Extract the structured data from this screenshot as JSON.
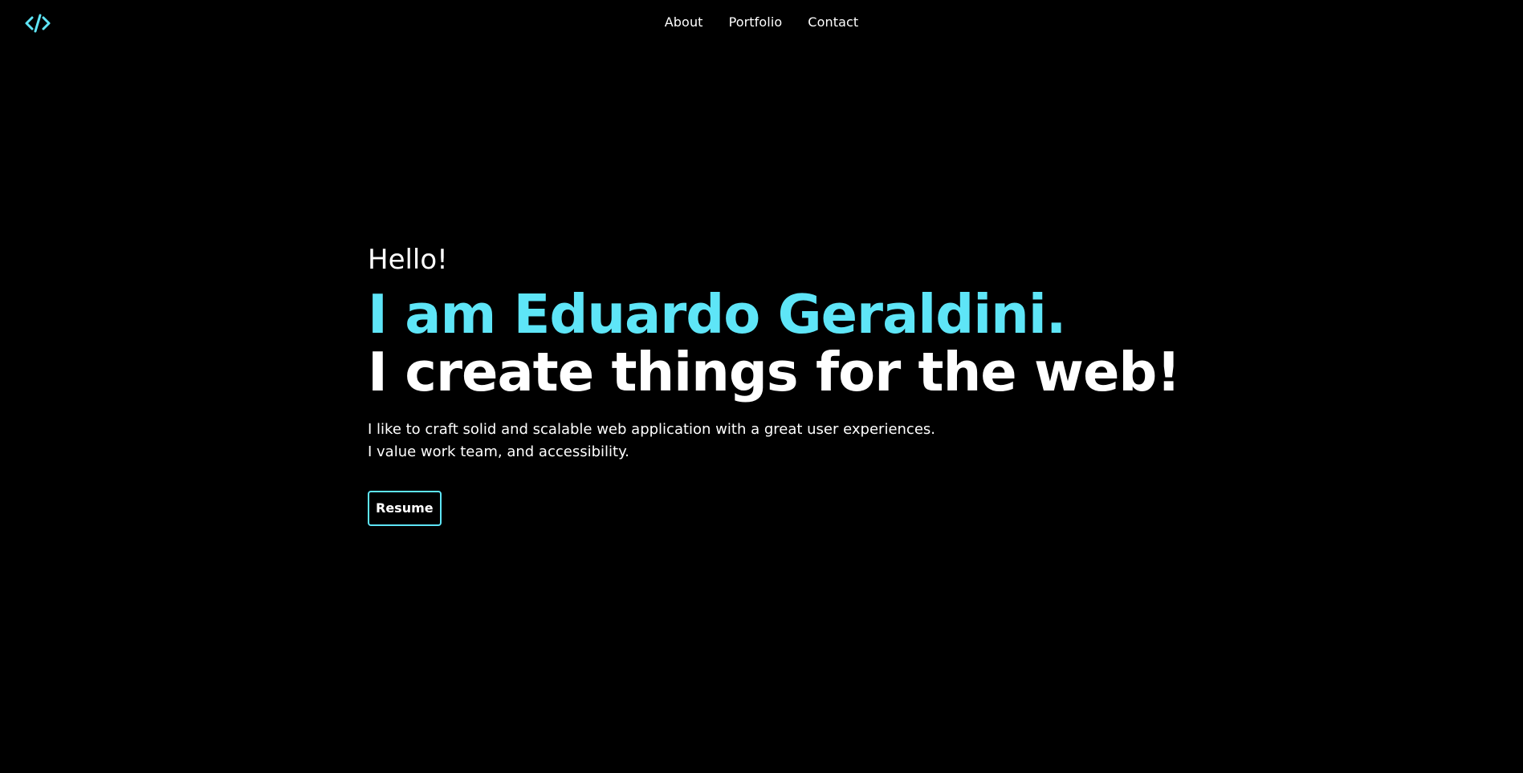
{
  "theme": {
    "background": "#000000",
    "accent": "#5ee5f7",
    "text": "#ffffff"
  },
  "header": {
    "logo_icon": "code-brackets-icon",
    "nav": [
      {
        "label": "About"
      },
      {
        "label": "Portfolio"
      },
      {
        "label": "Contact"
      }
    ]
  },
  "hero": {
    "greeting": "Hello!",
    "name_line": "I am Eduardo Geraldini.",
    "tagline": "I create things for the web!",
    "description": [
      "I like to craft solid and scalable web application with a great user experiences.",
      "I value work team, and accessibility."
    ],
    "resume_label": "Resume"
  }
}
